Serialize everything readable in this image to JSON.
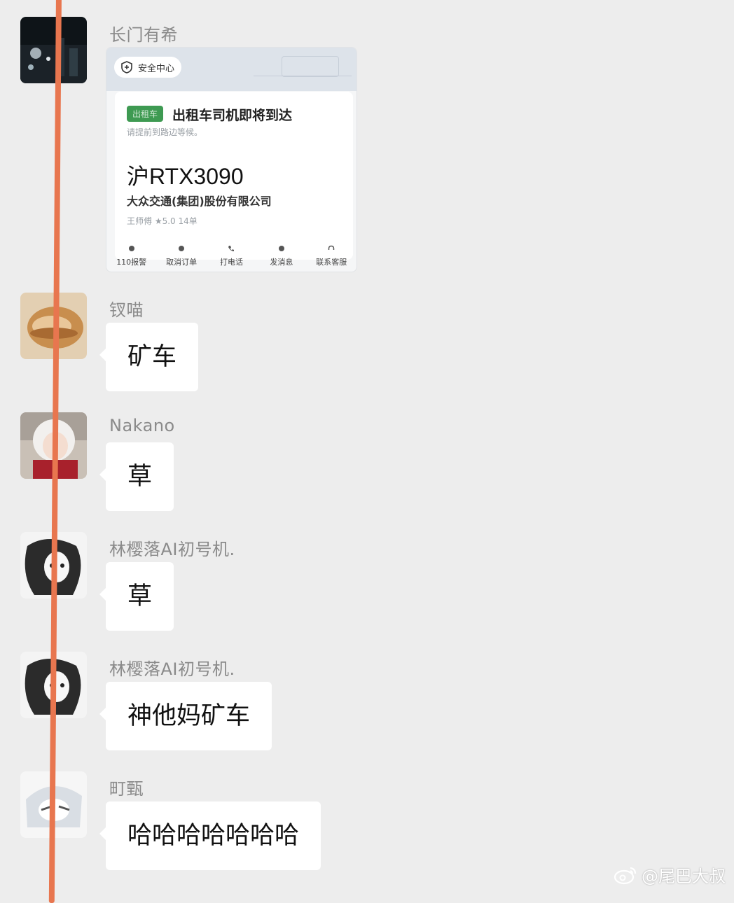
{
  "messages": [
    {
      "sender": "长门有希",
      "card": {
        "safety_label": "安全中心",
        "tag": "出租车",
        "title": "出租车司机即将到达",
        "subtitle": "请提前到路边等候。",
        "plate": "沪RTX3090",
        "company": "大众交通(集团)股份有限公司",
        "driver": "王师傅  ★5.0  14单",
        "actions": [
          "110报警",
          "取消订单",
          "打电话",
          "发消息",
          "联系客服"
        ]
      }
    },
    {
      "sender": "钗喵",
      "text": "矿车"
    },
    {
      "sender": "Nakano",
      "text": "草"
    },
    {
      "sender": "林樱落AI初号机.",
      "text": "草"
    },
    {
      "sender": "林樱落AI初号机.",
      "text": "神他妈矿车"
    },
    {
      "sender": "町甄",
      "text": "哈哈哈哈哈哈哈"
    }
  ],
  "watermark": "@尾巴大叔",
  "colors": {
    "background": "#ededed",
    "bubble": "#ffffff",
    "annotation_line": "#e8764f"
  }
}
